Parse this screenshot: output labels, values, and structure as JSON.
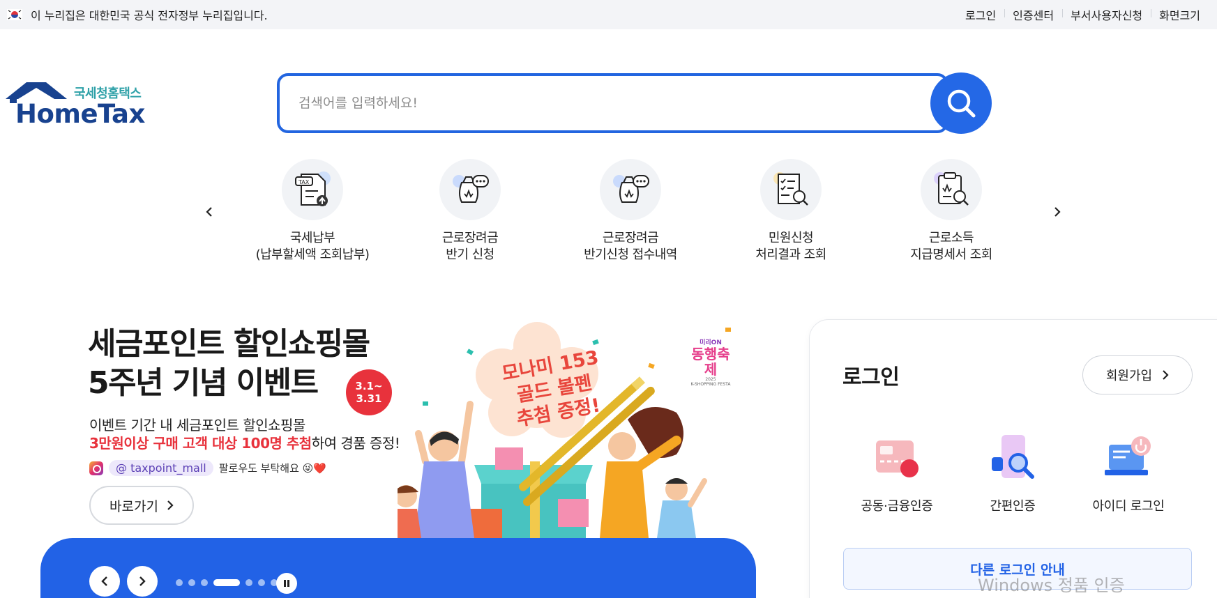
{
  "gov_bar": {
    "notice": "이 누리집은 대한민국 공식 전자정부 누리집입니다.",
    "links": [
      "로그인",
      "인증센터",
      "부서사용자신청",
      "화면크기"
    ]
  },
  "logo": {
    "korean": "국세청홈택스",
    "english": "HomeTax"
  },
  "search": {
    "placeholder": "검색어를 입력하세요!",
    "value": ""
  },
  "quick_menu": [
    {
      "line1": "국세납부",
      "line2": "(납부할세액 조회납부)",
      "icon": "tax-upload-icon"
    },
    {
      "line1": "근로장려금",
      "line2": "반기 신청",
      "icon": "money-bag-chat-icon"
    },
    {
      "line1": "근로장려금",
      "line2": "반기신청 접수내역",
      "icon": "money-bag-chat-icon"
    },
    {
      "line1": "민원신청",
      "line2": "처리결과 조회",
      "icon": "checklist-search-icon"
    },
    {
      "line1": "근로소득",
      "line2": "지급명세서 조회",
      "icon": "clipboard-search-icon"
    }
  ],
  "banner": {
    "title_line1": "세금포인트 할인쇼핑몰",
    "title_line2": "5주년 기념 이벤트",
    "badge_line1": "3.1~",
    "badge_line2": "3.31",
    "sub1": "이벤트 기간 내 세금포인트 할인쇼핑몰",
    "sub2_red": "3만원이상 구매 고객 대상 100명 추첨",
    "sub2_rest": "하여 경품 증정!",
    "insta_handle": "@ taxpoint_mall",
    "insta_note": "팔로우도 부탁해요 😜❤️",
    "go_label": "바로가기",
    "prize_line1": "모나미 153",
    "prize_line2": "골드 볼펜",
    "prize_line3": "추첨 증정!",
    "fest_small": "미리ON",
    "fest_main": "동행축제",
    "fest_year": "2025",
    "fest_sub": "K-SHOPPING FESTA"
  },
  "slider": {
    "total": 7,
    "current": 4
  },
  "login": {
    "title": "로그인",
    "join_label": "회원가입",
    "options": [
      {
        "label": "공동·금융인증",
        "icon": "certificate-card-icon"
      },
      {
        "label": "간편인증",
        "icon": "phone-search-icon"
      },
      {
        "label": "아이디 로그인",
        "icon": "laptop-power-icon"
      }
    ],
    "other_label": "다른 로그인 안내"
  },
  "watermark": "Windows 정품 인증",
  "colors": {
    "primary": "#2262e6",
    "logo_navy": "#18428f",
    "logo_teal": "#2fa1a8",
    "accent_red": "#e8323c"
  }
}
